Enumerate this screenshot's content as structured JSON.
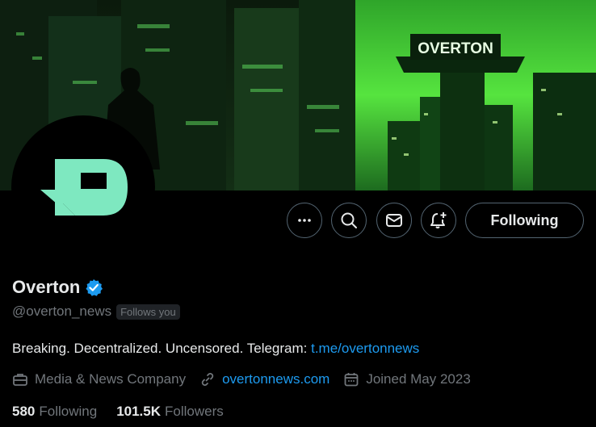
{
  "banner": {
    "sign_text": "OVERTON"
  },
  "actions": {
    "more_icon": "more-icon",
    "search_icon": "search-icon",
    "message_icon": "message-icon",
    "notify_icon": "bell-plus-icon",
    "following_label": "Following"
  },
  "profile": {
    "name": "Overton",
    "handle": "@overton_news",
    "follows_you": "Follows you",
    "bio_text": "Breaking. Decentralized. Uncensored. Telegram: ",
    "bio_link": "t.me/overtonnews",
    "category": "Media & News Company",
    "website": "overtonnews.com",
    "joined": "Joined May 2023",
    "following_count": "580",
    "following_label": "Following",
    "followers_count": "101.5K",
    "followers_label": "Followers"
  },
  "colors": {
    "accent": "#1d9bf0",
    "muted": "#71767b",
    "logo_mint": "#7ee8c0",
    "banner_green": "#3ddc3a"
  }
}
